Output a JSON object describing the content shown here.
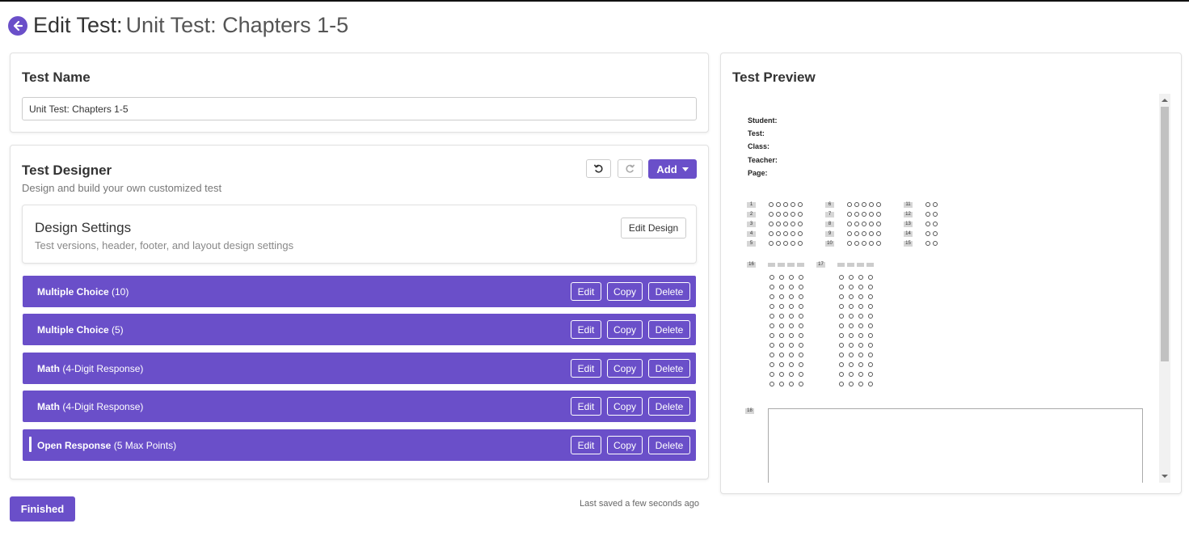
{
  "header": {
    "title_bold": "Edit Test:",
    "title_light": "Unit Test: Chapters 1-5"
  },
  "test_name_card": {
    "heading": "Test Name",
    "input_value": "Unit Test: Chapters 1-5"
  },
  "designer": {
    "heading": "Test Designer",
    "subtitle": "Design and build your own customized test",
    "add_label": "Add",
    "settings": {
      "heading": "Design Settings",
      "subtitle": "Test versions, header, footer, and layout design settings",
      "edit_label": "Edit Design"
    },
    "section_buttons": {
      "edit": "Edit",
      "copy": "Copy",
      "delete": "Delete"
    },
    "sections": [
      {
        "name": "Multiple Choice",
        "detail": "(10)"
      },
      {
        "name": "Multiple Choice",
        "detail": "(5)"
      },
      {
        "name": "Math",
        "detail": "(4-Digit Response)"
      },
      {
        "name": "Math",
        "detail": "(4-Digit Response)"
      },
      {
        "name": "Open Response",
        "detail": "(5 Max Points)"
      }
    ]
  },
  "footer": {
    "finished_label": "Finished",
    "saved_status": "Last saved a few seconds ago"
  },
  "preview": {
    "heading": "Test Preview",
    "header_fields": [
      "Student:",
      "Test:",
      "Class:",
      "Teacher:",
      "Page:"
    ],
    "mc_columns": [
      {
        "numbers": [
          "1",
          "2",
          "3",
          "4",
          "5"
        ],
        "bubbles": 5
      },
      {
        "numbers": [
          "6",
          "7",
          "8",
          "9",
          "10"
        ],
        "bubbles": 5
      },
      {
        "numbers": [
          "11",
          "12",
          "13",
          "14",
          "15"
        ],
        "bubbles": 2
      }
    ],
    "math_questions": [
      "16",
      "17"
    ],
    "open_question": "18"
  },
  "colors": {
    "accent": "#6a4fc9"
  },
  "icons": {
    "back": "arrow-circle-left-icon",
    "undo": "undo-icon",
    "redo": "redo-icon",
    "add_caret": "caret-down-icon"
  }
}
